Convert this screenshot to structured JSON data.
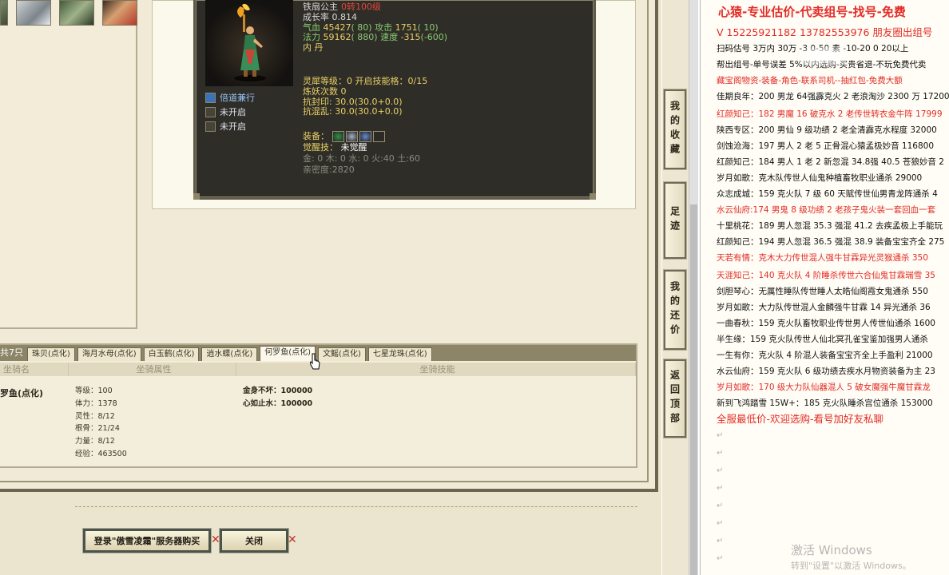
{
  "pet": {
    "name": "铁扇公主",
    "rebirth": "0转100级",
    "growth_label": "成长率",
    "growth": "0.814",
    "hp_label": "气血",
    "hp": "45427",
    "hp_pts": "( 80)",
    "atk_label": "攻击",
    "atk": "1751",
    "atk_pts": "( 10)",
    "mp_label": "法力",
    "mp": "59162",
    "mp_pts": "( 880)",
    "spd_label": "速度",
    "spd": "-315",
    "spd_pts": "(-600)",
    "inner": "内  丹",
    "spirit_level": "灵犀等级：0 开启技能格：0/15",
    "refine": "炼妖次数 0",
    "resist_seal": "抗封印: 30.0(30.0+0.0)",
    "resist_chaos": "抗混乱: 30.0(30.0+0.0)",
    "equip_label": "装备：",
    "awaken_label": "觉醒技：",
    "awaken_value": "未觉醒",
    "elements": "金: 0  木: 0  水: 0  火:40  土:60",
    "intimacy": "亲密度:2820",
    "skills": [
      {
        "label": "倍道兼行",
        "icon": "feather-skill-icon"
      },
      {
        "label": "未开启",
        "icon": "locked-skill-icon"
      },
      {
        "label": "未开启",
        "icon": "locked-skill-icon"
      }
    ]
  },
  "mount_tabs": {
    "count": "共7只",
    "items": [
      "珠贝(点化)",
      "海月水母(点化)",
      "白玉鹤(点化)",
      "逍水蝶(点化)",
      "何罗鱼(点化)",
      "文鳐(点化)",
      "七星龙珠(点化)"
    ],
    "active_index": 4
  },
  "mount_table": {
    "headers": [
      "坐骑名",
      "坐骑属性",
      "坐骑技能"
    ],
    "name": "罗鱼(点化)",
    "attrs": [
      "等级：100",
      "体力：1378",
      "灵性：8/12",
      "根骨：21/24",
      "力量：8/12",
      "经验：463500"
    ],
    "skills": [
      "金身不坏：100000",
      "心如止水：100000"
    ]
  },
  "buttons": {
    "login": "登录\"傲雪凌霜\"服务器购买",
    "close": "关闭",
    "x": "✕"
  },
  "side_nav": [
    "我的收藏",
    "足迹",
    "我的还价",
    "返回顶部"
  ],
  "doc": {
    "title": "心猿-专业估价-代卖组号-找号-免费",
    "lines": [
      {
        "text": "V 15225921182   13782553976 朋友圈出组号",
        "red": true,
        "big": true
      },
      {
        "text": "扫码估号 3万内 30万 -3 0-50 素 -10-20 0 20以上",
        "red": false
      },
      {
        "text": "帮出组号-单号误差 5%以内选购-买贵省退-不玩免费代卖",
        "red": false
      },
      {
        "text": "藏宝阁物资-装备-角色-联系司机--抽红包-免费大额",
        "red": true
      },
      {
        "text": "佳期良年：200 男龙 64强霹克火 2 老浪淘沙 2300 万 17200",
        "red": false
      },
      {
        "text": "红颜知己：182 男魔 16 破克水 2 老传世转衣金牛阵 17999",
        "red": true
      },
      {
        "text": "陕西专区：200 男仙 9 级功绩 2 老全清霹克水程度 32000",
        "red": false
      },
      {
        "text": "剑蚀沧海：197 男人 2 老 5 正骨混心猿孟极妙音 116800",
        "red": false
      },
      {
        "text": "红颜知己：184 男人 1 老 2 新忽混 34.8强 40.5 苍狼妙音 2",
        "red": false
      },
      {
        "text": "岁月如歌：克木队传世人仙鬼种植畜牧职业通杀 29000",
        "red": false
      },
      {
        "text": "众志成城：159 克火队 7 级 60 天赋传世仙男青龙阵通杀 4",
        "red": false
      },
      {
        "text": "水云仙府:174 男鬼 8 级功绩 2 老孩子鬼火装一套回血一套",
        "red": true
      },
      {
        "text": "十里桃花：189 男人忽混 35.3 强混 41.2 去疾孟极上手能玩",
        "red": false
      },
      {
        "text": "红颜知己：194 男人忽混 36.5 强混 38.9 装备宝宝齐全 275",
        "red": false
      },
      {
        "text": "天若有情：克木大力传世混人强牛甘霖异光灵猴通杀 350",
        "red": true
      },
      {
        "text": "天涯知己：140 克火队 4 阶睡杀传世六合仙鬼甘霖瑞雪 35",
        "red": true
      },
      {
        "text": "剑胆琴心：无属性睡队传世睡人太皓仙阁霞女鬼通杀 550",
        "red": false
      },
      {
        "text": "岁月如歌：大力队传世混人金麟强牛甘霖 14 异光通杀 36",
        "red": false
      },
      {
        "text": "一曲春秋：159 克火队畜牧职业传世男人传世仙通杀 1600",
        "red": false
      },
      {
        "text": "半生缘：159 克火队传世人仙北冥孔雀宝鉴加强男人通杀",
        "red": false
      },
      {
        "text": "一生有你：克火队 4 阶混人装备宝宝齐全上手盈利 21000",
        "red": false
      },
      {
        "text": "水云仙府：159 克火队 6 级功绩去疾水月物资装备为主 23",
        "red": false
      },
      {
        "text": "岁月如歌：170 级大力队仙器混人 5 破女魔强牛魔甘霖龙",
        "red": true
      },
      {
        "text": "新到飞鸿踏雪 15W+：185 克火队睡杀宫位通杀 153000",
        "red": false
      },
      {
        "text": "全服最低价-欢迎选购-看号加好友私聊",
        "red": true,
        "big": true
      }
    ],
    "watermark": "激活 Windows",
    "watermark_sub": "转到\"设置\"以激活 Windows。"
  },
  "colors": {
    "accent_red": "#e32b26",
    "frame_dark": "#2f2d27",
    "gold": "#e8d068",
    "green": "#8acb73"
  }
}
